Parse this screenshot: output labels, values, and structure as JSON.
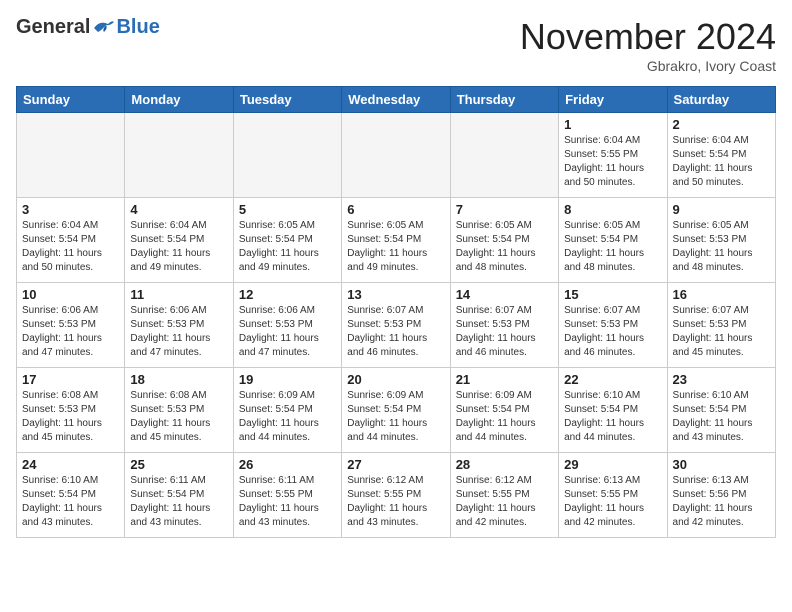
{
  "header": {
    "logo_general": "General",
    "logo_blue": "Blue",
    "month_title": "November 2024",
    "location": "Gbrakro, Ivory Coast"
  },
  "calendar": {
    "days_of_week": [
      "Sunday",
      "Monday",
      "Tuesday",
      "Wednesday",
      "Thursday",
      "Friday",
      "Saturday"
    ],
    "weeks": [
      [
        {
          "day": "",
          "empty": true
        },
        {
          "day": "",
          "empty": true
        },
        {
          "day": "",
          "empty": true
        },
        {
          "day": "",
          "empty": true
        },
        {
          "day": "",
          "empty": true
        },
        {
          "day": "1",
          "sunrise": "6:04 AM",
          "sunset": "5:55 PM",
          "daylight": "11 hours and 50 minutes."
        },
        {
          "day": "2",
          "sunrise": "6:04 AM",
          "sunset": "5:54 PM",
          "daylight": "11 hours and 50 minutes."
        }
      ],
      [
        {
          "day": "3",
          "sunrise": "6:04 AM",
          "sunset": "5:54 PM",
          "daylight": "11 hours and 50 minutes."
        },
        {
          "day": "4",
          "sunrise": "6:04 AM",
          "sunset": "5:54 PM",
          "daylight": "11 hours and 49 minutes."
        },
        {
          "day": "5",
          "sunrise": "6:05 AM",
          "sunset": "5:54 PM",
          "daylight": "11 hours and 49 minutes."
        },
        {
          "day": "6",
          "sunrise": "6:05 AM",
          "sunset": "5:54 PM",
          "daylight": "11 hours and 49 minutes."
        },
        {
          "day": "7",
          "sunrise": "6:05 AM",
          "sunset": "5:54 PM",
          "daylight": "11 hours and 48 minutes."
        },
        {
          "day": "8",
          "sunrise": "6:05 AM",
          "sunset": "5:54 PM",
          "daylight": "11 hours and 48 minutes."
        },
        {
          "day": "9",
          "sunrise": "6:05 AM",
          "sunset": "5:53 PM",
          "daylight": "11 hours and 48 minutes."
        }
      ],
      [
        {
          "day": "10",
          "sunrise": "6:06 AM",
          "sunset": "5:53 PM",
          "daylight": "11 hours and 47 minutes."
        },
        {
          "day": "11",
          "sunrise": "6:06 AM",
          "sunset": "5:53 PM",
          "daylight": "11 hours and 47 minutes."
        },
        {
          "day": "12",
          "sunrise": "6:06 AM",
          "sunset": "5:53 PM",
          "daylight": "11 hours and 47 minutes."
        },
        {
          "day": "13",
          "sunrise": "6:07 AM",
          "sunset": "5:53 PM",
          "daylight": "11 hours and 46 minutes."
        },
        {
          "day": "14",
          "sunrise": "6:07 AM",
          "sunset": "5:53 PM",
          "daylight": "11 hours and 46 minutes."
        },
        {
          "day": "15",
          "sunrise": "6:07 AM",
          "sunset": "5:53 PM",
          "daylight": "11 hours and 46 minutes."
        },
        {
          "day": "16",
          "sunrise": "6:07 AM",
          "sunset": "5:53 PM",
          "daylight": "11 hours and 45 minutes."
        }
      ],
      [
        {
          "day": "17",
          "sunrise": "6:08 AM",
          "sunset": "5:53 PM",
          "daylight": "11 hours and 45 minutes."
        },
        {
          "day": "18",
          "sunrise": "6:08 AM",
          "sunset": "5:53 PM",
          "daylight": "11 hours and 45 minutes."
        },
        {
          "day": "19",
          "sunrise": "6:09 AM",
          "sunset": "5:54 PM",
          "daylight": "11 hours and 44 minutes."
        },
        {
          "day": "20",
          "sunrise": "6:09 AM",
          "sunset": "5:54 PM",
          "daylight": "11 hours and 44 minutes."
        },
        {
          "day": "21",
          "sunrise": "6:09 AM",
          "sunset": "5:54 PM",
          "daylight": "11 hours and 44 minutes."
        },
        {
          "day": "22",
          "sunrise": "6:10 AM",
          "sunset": "5:54 PM",
          "daylight": "11 hours and 44 minutes."
        },
        {
          "day": "23",
          "sunrise": "6:10 AM",
          "sunset": "5:54 PM",
          "daylight": "11 hours and 43 minutes."
        }
      ],
      [
        {
          "day": "24",
          "sunrise": "6:10 AM",
          "sunset": "5:54 PM",
          "daylight": "11 hours and 43 minutes."
        },
        {
          "day": "25",
          "sunrise": "6:11 AM",
          "sunset": "5:54 PM",
          "daylight": "11 hours and 43 minutes."
        },
        {
          "day": "26",
          "sunrise": "6:11 AM",
          "sunset": "5:55 PM",
          "daylight": "11 hours and 43 minutes."
        },
        {
          "day": "27",
          "sunrise": "6:12 AM",
          "sunset": "5:55 PM",
          "daylight": "11 hours and 43 minutes."
        },
        {
          "day": "28",
          "sunrise": "6:12 AM",
          "sunset": "5:55 PM",
          "daylight": "11 hours and 42 minutes."
        },
        {
          "day": "29",
          "sunrise": "6:13 AM",
          "sunset": "5:55 PM",
          "daylight": "11 hours and 42 minutes."
        },
        {
          "day": "30",
          "sunrise": "6:13 AM",
          "sunset": "5:56 PM",
          "daylight": "11 hours and 42 minutes."
        }
      ]
    ]
  }
}
